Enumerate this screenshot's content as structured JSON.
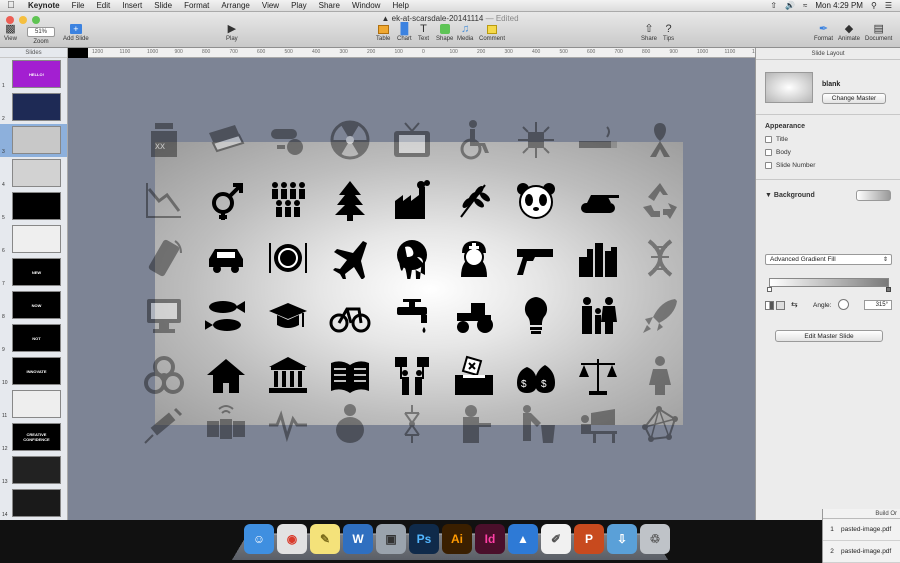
{
  "menubar": {
    "app_name": "Keynote",
    "items": [
      "File",
      "Edit",
      "Insert",
      "Slide",
      "Format",
      "Arrange",
      "View",
      "Play",
      "Share",
      "Window",
      "Help"
    ],
    "time": "Mon 4:29 PM"
  },
  "window": {
    "doc_title": "ek-at-scarsdale-20141114",
    "edited_label": "— Edited"
  },
  "toolbar": {
    "view_label": "View",
    "zoom_value": "51%",
    "zoom_label": "Zoom",
    "add_slide_label": "Add Slide",
    "play_label": "Play",
    "table_label": "Table",
    "chart_label": "Chart",
    "text_label": "Text",
    "shape_label": "Shape",
    "media_label": "Media",
    "comment_label": "Comment",
    "share_label": "Share",
    "tips_label": "Tips",
    "format_label": "Format",
    "animate_label": "Animate",
    "document_label": "Document"
  },
  "ruler": {
    "ticks": [
      "1200",
      "1100",
      "1000",
      "900",
      "800",
      "700",
      "600",
      "500",
      "400",
      "300",
      "200",
      "100",
      "0",
      "100",
      "200",
      "300",
      "400",
      "500",
      "600",
      "700",
      "800",
      "900",
      "1000",
      "1100",
      "1200"
    ]
  },
  "navigator": {
    "header": "Slides",
    "slides": [
      {
        "num": "1",
        "text": "HELLO!",
        "bg": "#a31fd1"
      },
      {
        "num": "2",
        "text": "",
        "bg": "#1e2a55"
      },
      {
        "num": "3",
        "text": "",
        "bg": "#c8c8c8"
      },
      {
        "num": "4",
        "text": "",
        "bg": "#d2d2d2"
      },
      {
        "num": "5",
        "text": "",
        "bg": "#000000"
      },
      {
        "num": "6",
        "text": "",
        "bg": "#efefef"
      },
      {
        "num": "7",
        "text": "NEW",
        "bg": "#000000"
      },
      {
        "num": "8",
        "text": "NOW",
        "bg": "#000000"
      },
      {
        "num": "9",
        "text": "NOT",
        "bg": "#000000"
      },
      {
        "num": "10",
        "text": "INNOVATE",
        "bg": "#000000"
      },
      {
        "num": "11",
        "text": "",
        "bg": "#eeeeee"
      },
      {
        "num": "12",
        "text": "CREATIVE CONFIDENCE",
        "bg": "#000000"
      },
      {
        "num": "13",
        "text": "",
        "bg": "#222222"
      },
      {
        "num": "14",
        "text": "",
        "bg": "#1a1a1a"
      }
    ],
    "selected_index": 2
  },
  "inspector": {
    "title": "Slide Layout",
    "layout_name": "blank",
    "change_master_label": "Change Master",
    "appearance_label": "Appearance",
    "title_check": "Title",
    "body_check": "Body",
    "slide_number_check": "Slide Number",
    "background_label": "Background",
    "fill_type": "Advanced Gradient Fill",
    "angle_label": "Angle:",
    "angle_value": "315°",
    "edit_master_label": "Edit Master Slide"
  },
  "build_order": {
    "header": "Build Or",
    "rows": [
      {
        "num": "1",
        "name": "pasted-image.pdf"
      },
      {
        "num": "2",
        "name": "pasted-image.pdf"
      }
    ]
  },
  "dock": {
    "apps": [
      {
        "name": "finder",
        "glyph": "☺",
        "bg": "#3f8fe0",
        "fg": "#ffffff"
      },
      {
        "name": "chrome",
        "glyph": "◉",
        "bg": "#e2e2e2",
        "fg": "#d93a2b"
      },
      {
        "name": "stickies",
        "glyph": "✎",
        "bg": "#f4e27a",
        "fg": "#7a6a1a"
      },
      {
        "name": "word",
        "glyph": "W",
        "bg": "#2f6fc0",
        "fg": "#ffffff"
      },
      {
        "name": "preview",
        "glyph": "▣",
        "bg": "#9aa3ad",
        "fg": "#333333"
      },
      {
        "name": "photoshop",
        "glyph": "Ps",
        "bg": "#0f2a4a",
        "fg": "#52b6ff"
      },
      {
        "name": "illustrator",
        "glyph": "Ai",
        "bg": "#3a1f00",
        "fg": "#ff9a00"
      },
      {
        "name": "indesign",
        "glyph": "Id",
        "bg": "#4a0f2b",
        "fg": "#ff3fa6"
      },
      {
        "name": "keynote",
        "glyph": "▲",
        "bg": "#2e7ad6",
        "fg": "#ffffff"
      },
      {
        "name": "textedit",
        "glyph": "✐",
        "bg": "#f1f1f1",
        "fg": "#555555"
      },
      {
        "name": "powerpoint",
        "glyph": "P",
        "bg": "#c84a1e",
        "fg": "#ffffff"
      },
      {
        "name": "downloads",
        "glyph": "⇩",
        "bg": "#5aa0d8",
        "fg": "#ffffff"
      },
      {
        "name": "trash",
        "glyph": "♲",
        "bg": "#bfc3c8",
        "fg": "#555555"
      }
    ]
  },
  "colors": {
    "selection_blue": "#8db0dc",
    "canvas_gray": "#7d8495"
  },
  "slide_icons": [
    "poison-bottle-icon",
    "newspaper-icon",
    "pills-icon",
    "radiation-icon",
    "tv-icon",
    "wheelchair-icon",
    "circuit-chip-icon",
    "cigarette-icon",
    "ribbon-icon",
    "stock-down-icon",
    "gender-icon",
    "crowd-icon",
    "tree-icon",
    "factory-icon",
    "wheat-icon",
    "panda-icon",
    "tank-icon",
    "recycle-icon",
    "phone-icon",
    "car-icon",
    "dinner-plate-icon",
    "airplane-icon",
    "melting-earth-icon",
    "nurse-icon",
    "gun-icon",
    "city-skyline-icon",
    "dna-icon",
    "computer-icon",
    "fish-icon",
    "graduation-cap-icon",
    "bicycle-icon",
    "faucet-icon",
    "tractor-icon",
    "lightbulb-icon",
    "family-icon",
    "rocket-icon",
    "biohazard-icon",
    "house-icon",
    "bank-icon",
    "book-icon",
    "protest-icon",
    "ballot-box-icon",
    "money-bags-icon",
    "scales-icon",
    "woman-icon",
    "syringe-icon",
    "satellite-icon",
    "heartbeat-icon",
    "obese-person-icon",
    "virus-icon",
    "worker-icon",
    "garbage-person-icon",
    "desk-worker-icon",
    "network-icon"
  ]
}
